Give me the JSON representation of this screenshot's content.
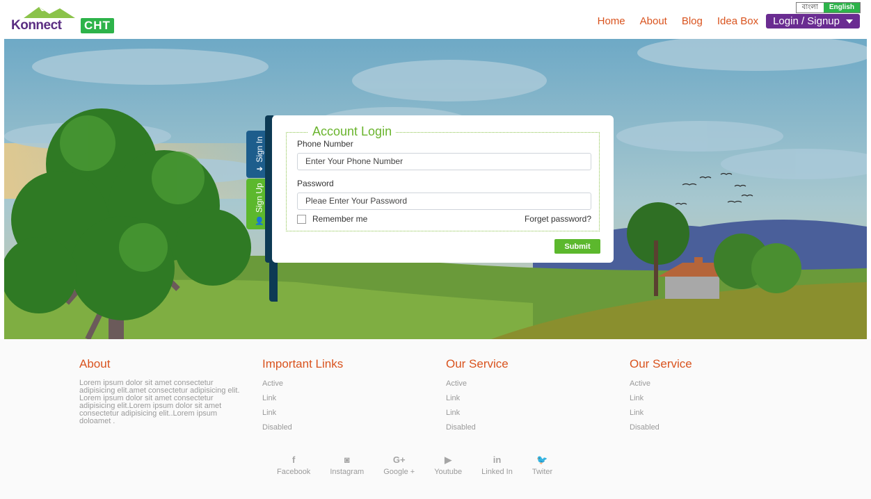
{
  "header": {
    "logo_text": "Konnect",
    "logo_tag": "CHT",
    "lang": {
      "bangla": "বাংলা",
      "english": "English"
    },
    "nav": [
      {
        "label": "Home"
      },
      {
        "label": "About"
      },
      {
        "label": "Blog"
      },
      {
        "label": "Idea Box"
      }
    ],
    "login_label": "Login / Signup"
  },
  "login": {
    "tab_signin": "Sign In",
    "tab_signup": "Sign Up",
    "title": "Account Login",
    "phone_label": "Phone Number",
    "phone_placeholder": "Enter Your Phone Number",
    "password_label": "Password",
    "password_placeholder": "Pleae Enter Your Password",
    "remember_label": "Remember me",
    "forgot_label": "Forget password?",
    "submit_label": "Submit"
  },
  "footer": {
    "about": {
      "title": "About",
      "text": "Lorem ipsum dolor sit amet consectetur adipisicing elit.amet consectetur adipisicing elit. Lorem ipsum dolor sit amet consectetur adipisicing elit.Lorem ipsum dolor sit amet consectetur adipisicing elit..Lorem ipsum doloamet ."
    },
    "columns": [
      {
        "title": "Important Links",
        "items": [
          "Active",
          "Link",
          "Link",
          "Disabled"
        ]
      },
      {
        "title": "Our Service",
        "items": [
          "Active",
          "Link",
          "Link",
          "Disabled"
        ]
      },
      {
        "title": "Our Service",
        "items": [
          "Active",
          "Link",
          "Link",
          "Disabled"
        ]
      }
    ],
    "socials": [
      {
        "label": "Facebook",
        "icon": "facebook-icon",
        "glyph": "f"
      },
      {
        "label": "Instagram",
        "icon": "instagram-icon",
        "glyph": "◙"
      },
      {
        "label": "Google +",
        "icon": "google-plus-icon",
        "glyph": "G+"
      },
      {
        "label": "Youtube",
        "icon": "youtube-icon",
        "glyph": "▶"
      },
      {
        "label": "Linked In",
        "icon": "linkedin-icon",
        "glyph": "in"
      },
      {
        "label": "Twiter",
        "icon": "twitter-icon",
        "glyph": "🐦"
      }
    ]
  },
  "colors": {
    "accent_orange": "#d9531e",
    "brand_purple": "#6a2c91",
    "brand_green": "#5cb82d",
    "signin_blue": "#1d5d8c"
  }
}
